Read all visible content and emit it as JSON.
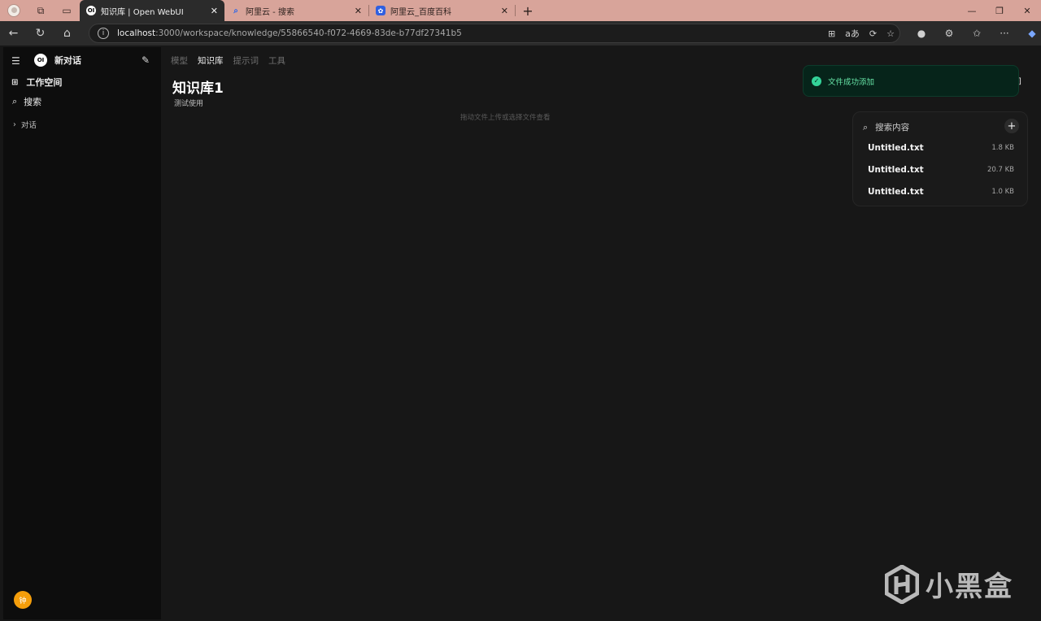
{
  "browser": {
    "tabs": [
      {
        "favicon": "OI",
        "title": "知识库 | Open WebUI",
        "active": true
      },
      {
        "favicon": "search-icon",
        "title": "阿里云 - 搜索",
        "active": false
      },
      {
        "favicon": "baidu-paw-icon",
        "title": "阿里云_百度百科",
        "active": false
      }
    ],
    "url_host": "localhost",
    "url_path": ":3000/workspace/knowledge/55866540-f072-4669-83de-b77df27341b5"
  },
  "sidebar": {
    "logo": "OI",
    "new_chat": "新对话",
    "workspace": "工作空间",
    "search": "搜索",
    "chats_section": "对话",
    "user_initial": "钟"
  },
  "main": {
    "nav": {
      "models": "模型",
      "knowledge": "知识库",
      "prompts": "提示词",
      "tools": "工具"
    },
    "title": "知识库1",
    "description": "测试使用",
    "drop_hint": "拖动文件上传或选择文件查看"
  },
  "toast": {
    "message": "文件成功添加"
  },
  "files_panel": {
    "search_placeholder": "搜索内容",
    "files": [
      {
        "name": "Untitled.txt",
        "size": "1.8 KB"
      },
      {
        "name": "Untitled.txt",
        "size": "20.7 KB"
      },
      {
        "name": "Untitled.txt",
        "size": "1.0 KB"
      }
    ]
  },
  "watermark": {
    "text": "小黑盒"
  },
  "colors": {
    "tabstrip": "#d8a49a",
    "toast_bg": "#06241a",
    "toast_text": "#66e3a6",
    "avatar": "#f59e0b"
  }
}
